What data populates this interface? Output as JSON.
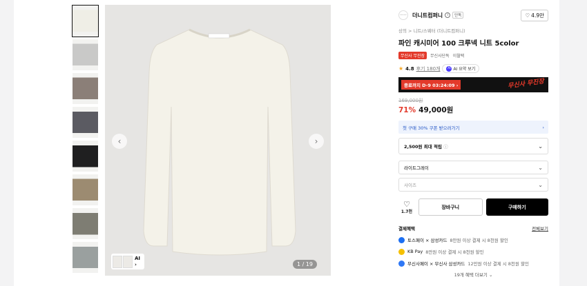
{
  "gallery": {
    "thumbnails": [
      {
        "tone": "#efeee6"
      },
      {
        "tone": "#c9c9c8"
      },
      {
        "tone": "#8b7f78"
      },
      {
        "tone": "#5b5b62"
      },
      {
        "tone": "#1f1f20"
      },
      {
        "tone": "#9c8b71"
      },
      {
        "tone": "#7e7d73"
      },
      {
        "tone": "#9aa09f"
      }
    ],
    "counter": "1 / 19",
    "ai_label": "AI",
    "ai_arrow": "›",
    "prev": "‹",
    "next": "›"
  },
  "brand": {
    "logo_text": "——",
    "name": "더니트컴퍼니",
    "info_mark": "i",
    "tag": "단독",
    "like_icon": "♡",
    "like_count": "4.9만"
  },
  "product": {
    "breadcrumb": "상의 > 니트/스웨터 (더니트컴퍼니)",
    "title": "파인 캐시미어 100 크루넥 니트 5color",
    "tags": [
      "무신사 무진장",
      "무신사단독",
      "이월택"
    ],
    "rating_star": "★",
    "rating": "4.8",
    "review_link": "후기 180개",
    "ai_summary": "AI 요약 보기",
    "ai_badge": "AI"
  },
  "promo": {
    "countdown": "종료까지 D-9 03:24:09 ›",
    "event_text": "무신사 무진장"
  },
  "pricing": {
    "original": "169,000원",
    "discount": "71%",
    "price": "49,000원"
  },
  "coupon": {
    "label": "첫 구매 30% 쿠폰 받으러가기",
    "arrow": "›"
  },
  "points": {
    "label": "2,500원 최대 적립",
    "info": "ⓘ",
    "chevron": "⌄"
  },
  "options": [
    {
      "label": "라이트그레이",
      "chevron": "⌄"
    },
    {
      "label": "사이즈",
      "chevron": "⌄"
    }
  ],
  "actions": {
    "heart_icon": "♡",
    "like_count": "1.7천",
    "cart": "장바구니",
    "buy": "구매하기"
  },
  "payment": {
    "title": "결제혜택",
    "view_all": "전체보기",
    "items": [
      {
        "name": "토스페이 × 삼성카드",
        "detail": "8만원 이상 결제 시 8천원 할인",
        "color": "#1c6ff2"
      },
      {
        "name": "KB Pay",
        "detail": "8만원 이상 결제 시 8천원 할인",
        "color": "#f5c000"
      },
      {
        "name": "무신사페이 × 무신사 삼성카드",
        "detail": "12만원 이상 결제 시 8천원 할인",
        "color": "#2f78f5"
      }
    ],
    "more": "19개 혜택 더보기 ⌄"
  }
}
